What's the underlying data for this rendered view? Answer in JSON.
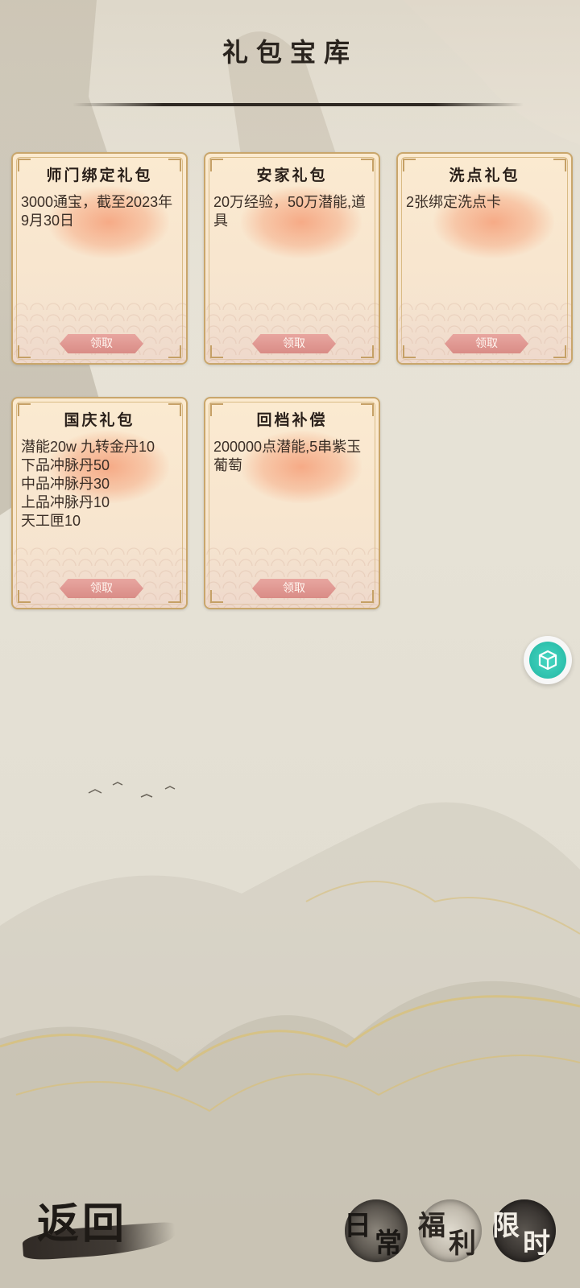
{
  "page": {
    "title": "礼包宝库"
  },
  "gifts": [
    {
      "title": "师门绑定礼包",
      "desc": "3000通宝，截至2023年9月30日",
      "button": "领取"
    },
    {
      "title": "安家礼包",
      "desc": "20万经验，50万潜能,道具",
      "button": "领取"
    },
    {
      "title": "洗点礼包",
      "desc": "2张绑定洗点卡",
      "button": "领取"
    },
    {
      "title": "国庆礼包",
      "desc": "潜能20w 九转金丹10\n下品冲脉丹50\n中品冲脉丹30\n上品冲脉丹10\n天工匣10",
      "button": "领取"
    },
    {
      "title": "回档补偿",
      "desc": "200000点潜能,5串紫玉葡萄",
      "button": "领取"
    }
  ],
  "nav": {
    "back": "返回",
    "daily": [
      "日",
      "常"
    ],
    "welfare": [
      "福",
      "利"
    ],
    "limited": [
      "限",
      "时"
    ]
  },
  "icons": {
    "floating_button": "cube-icon"
  },
  "colors": {
    "card_border": "#c9a66b",
    "claim_button": "#d98c86",
    "float_accent": "#22b6a3"
  }
}
